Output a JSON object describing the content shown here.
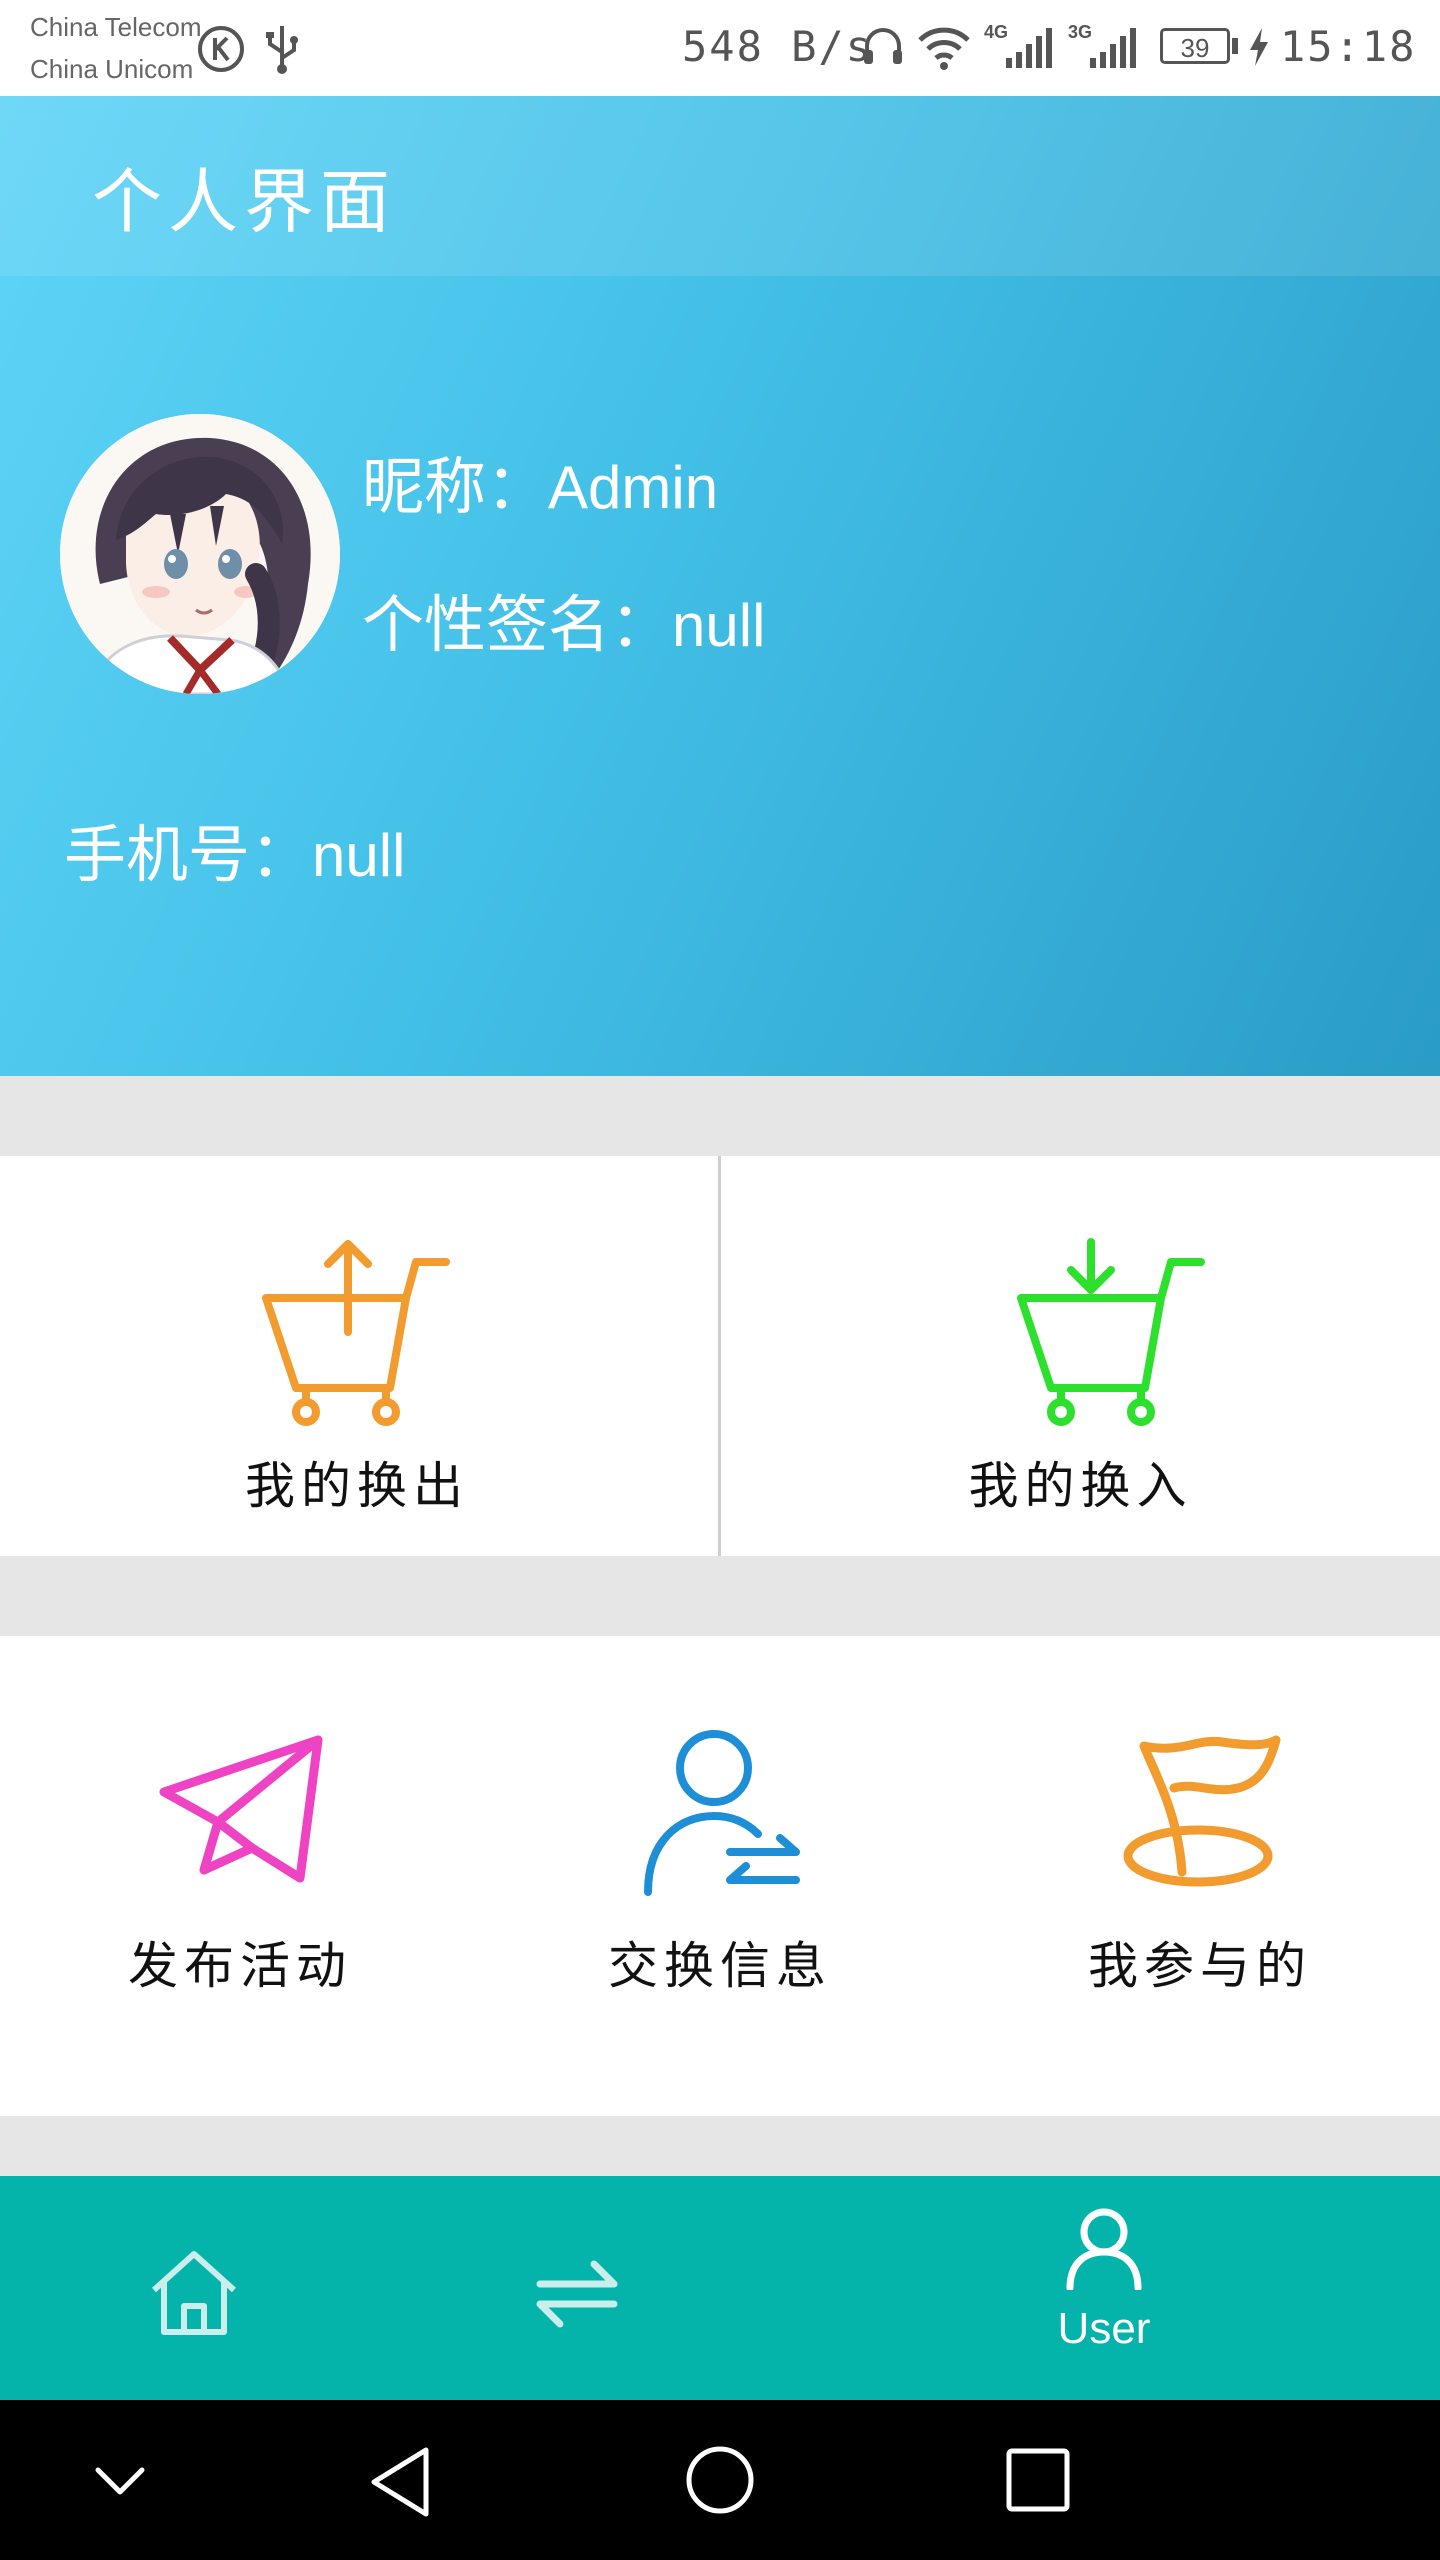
{
  "status_bar": {
    "carrier_1": "China  Telecom",
    "carrier_2": "China  Unicom",
    "net_speed": "548 B/s",
    "battery": "39",
    "time": "15:18",
    "network_1": "4G",
    "network_2": "3G"
  },
  "header": {
    "title": "个人界面",
    "nickname_label": "昵称：",
    "nickname_value": "Admin",
    "signature_label": "个性签名：",
    "signature_value": "null",
    "phone_label": "手机号：",
    "phone_value": "null"
  },
  "swap_card": {
    "items": [
      {
        "label": "我的换出",
        "icon": "cart-upload-icon",
        "color": "#f29b2f"
      },
      {
        "label": "我的换入",
        "icon": "cart-download-icon",
        "color": "#2ee02e"
      }
    ]
  },
  "action_card": {
    "items": [
      {
        "label": "发布活动",
        "icon": "paper-plane-icon",
        "color": "#ee44c4"
      },
      {
        "label": "交换信息",
        "icon": "user-exchange-icon",
        "color": "#1e8fd6"
      },
      {
        "label": "我参与的",
        "icon": "flag-icon",
        "color": "#f29b2f"
      }
    ]
  },
  "bottom_nav": {
    "items": [
      {
        "icon": "home-icon",
        "label": ""
      },
      {
        "icon": "exchange-arrows-icon",
        "label": ""
      },
      {
        "icon": "user-icon",
        "label": "User",
        "active": true
      }
    ]
  },
  "system_nav": [
    "hide-chevron-icon",
    "back-icon",
    "home-circle-icon",
    "recents-icon"
  ]
}
